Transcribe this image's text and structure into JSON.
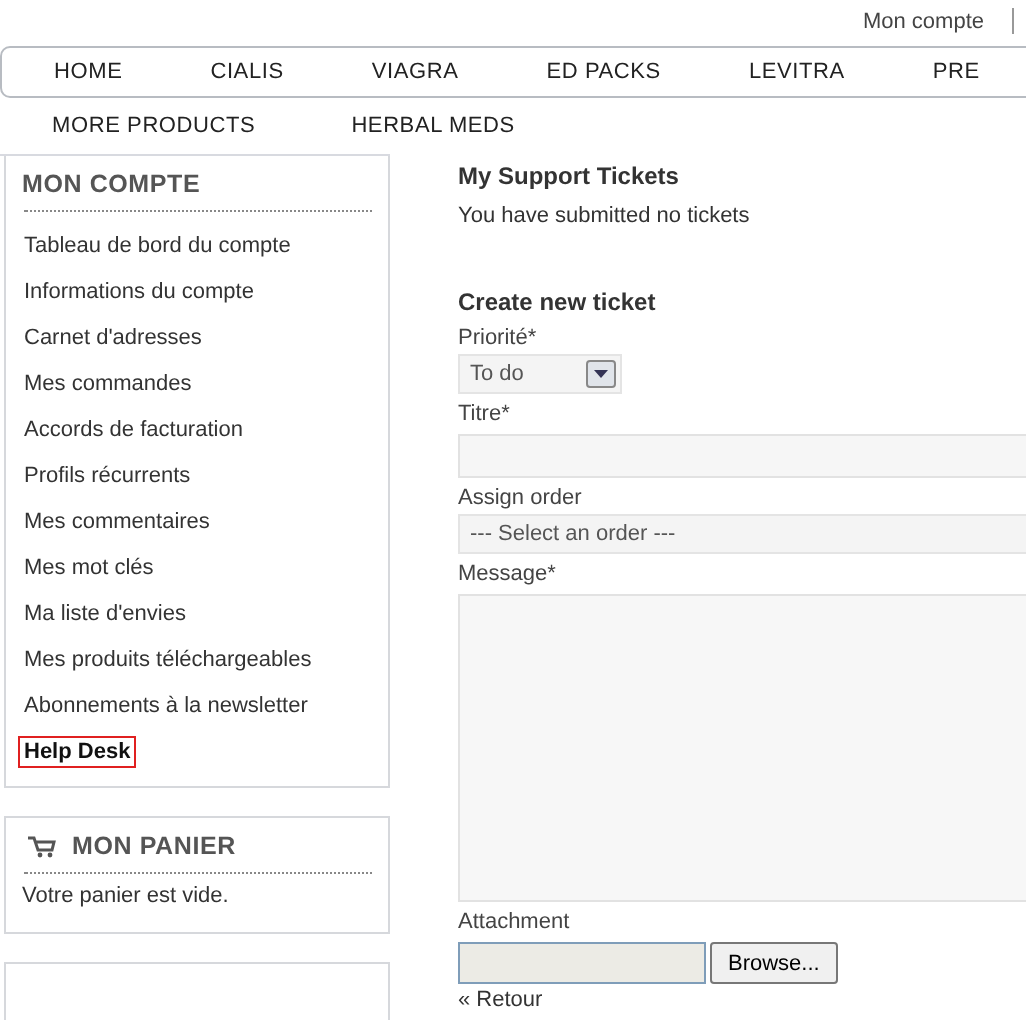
{
  "header": {
    "account_link": "Mon compte"
  },
  "nav": {
    "row_1": [
      "HOME",
      "CIALIS",
      "VIAGRA",
      "ED PACKS",
      "LEVITRA",
      "PRE"
    ],
    "row_2": [
      "MORE PRODUCTS",
      "HERBAL MEDS"
    ]
  },
  "sidebar": {
    "account": {
      "title": "MON COMPTE",
      "items": [
        {
          "label": "Tableau de bord du compte",
          "selected": false
        },
        {
          "label": "Informations du compte",
          "selected": false
        },
        {
          "label": "Carnet d'adresses",
          "selected": false
        },
        {
          "label": "Mes commandes",
          "selected": false
        },
        {
          "label": "Accords de facturation",
          "selected": false
        },
        {
          "label": "Profils récurrents",
          "selected": false
        },
        {
          "label": "Mes commentaires",
          "selected": false
        },
        {
          "label": "Mes mot clés",
          "selected": false
        },
        {
          "label": "Ma liste d'envies",
          "selected": false
        },
        {
          "label": "Mes produits téléchargeables",
          "selected": false
        },
        {
          "label": "Abonnements à la newsletter",
          "selected": false
        },
        {
          "label": "Help Desk",
          "selected": true
        }
      ]
    },
    "cart": {
      "title": "MON PANIER",
      "text": "Votre panier est vide."
    }
  },
  "main": {
    "tickets_title": "My Support Tickets",
    "tickets_text": "You have submitted no tickets",
    "form_title": "Create new ticket",
    "priority": {
      "label": "Priorité*",
      "value": "To do"
    },
    "title": {
      "label": "Titre*"
    },
    "order": {
      "label": "Assign order",
      "value": "--- Select an order ---"
    },
    "message": {
      "label": "Message*"
    },
    "attachment": {
      "label": "Attachment",
      "button": "Browse..."
    },
    "back_link": "« Retour"
  }
}
